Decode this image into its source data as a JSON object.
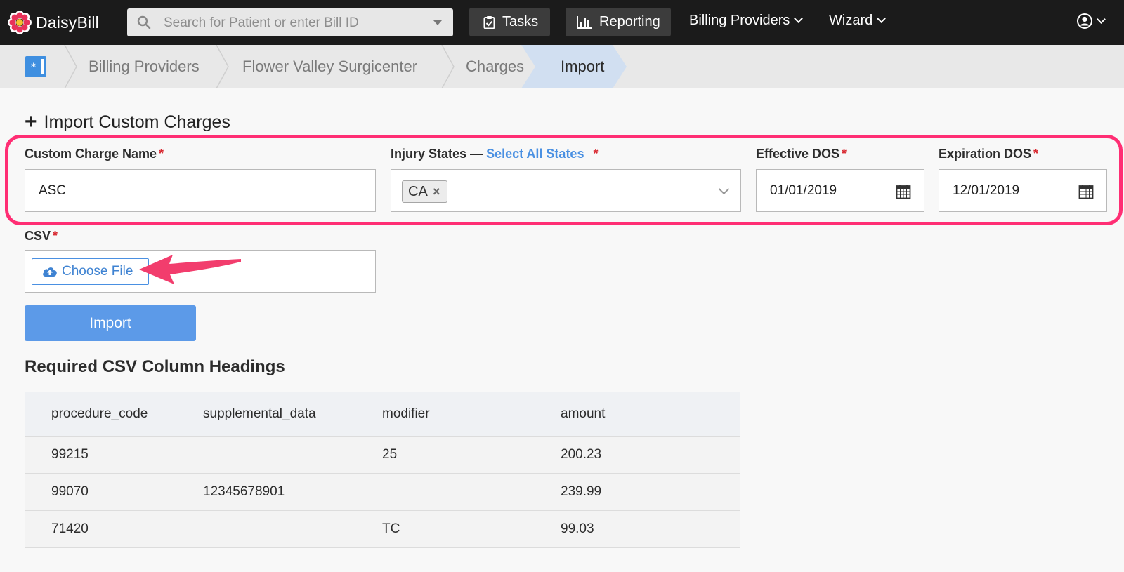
{
  "navbar": {
    "brand": "DaisyBill",
    "search_placeholder": "Search for Patient or enter Bill ID",
    "tasks_label": "Tasks",
    "reporting_label": "Reporting",
    "billing_providers_label": "Billing Providers",
    "wizard_label": "Wizard"
  },
  "breadcrumb": {
    "items": [
      "Billing Providers",
      "Flower Valley Surgicenter",
      "Charges"
    ],
    "active": "Import"
  },
  "page": {
    "title": "Import Custom Charges",
    "required_mark": "*"
  },
  "form": {
    "custom_charge_name": {
      "label": "Custom Charge Name",
      "value": "ASC"
    },
    "injury_states": {
      "label": "Injury States —",
      "link": "Select All States",
      "selected": [
        "CA"
      ],
      "remove_glyph": "×"
    },
    "effective_dos": {
      "label": "Effective DOS",
      "value": "01/01/2019"
    },
    "expiration_dos": {
      "label": "Expiration DOS",
      "value": "12/01/2019"
    },
    "csv": {
      "label": "CSV",
      "choose_file_label": "Choose File"
    },
    "import_label": "Import"
  },
  "required_headings": {
    "title": "Required CSV Column Headings",
    "columns": [
      "procedure_code",
      "supplemental_data",
      "modifier",
      "amount"
    ],
    "rows": [
      [
        "99215",
        "",
        "25",
        "200.23"
      ],
      [
        "99070",
        "12345678901",
        "",
        "239.99"
      ],
      [
        "71420",
        "",
        "TC",
        "99.03"
      ]
    ]
  },
  "colors": {
    "highlight": "#ff2e74",
    "accent": "#4a90e2",
    "import_button": "#5c9ae8",
    "navbar": "#1b1b1b"
  }
}
